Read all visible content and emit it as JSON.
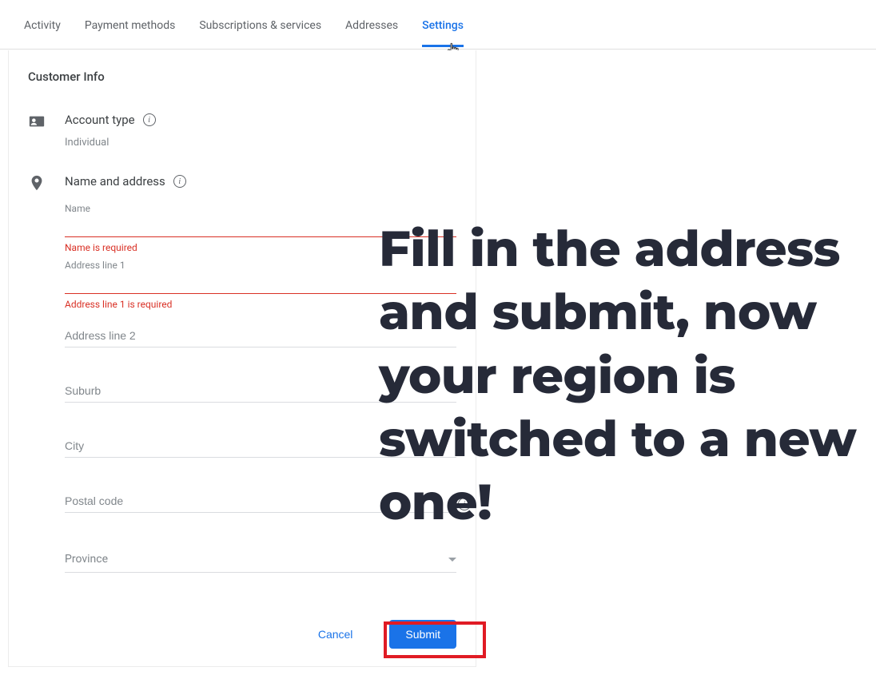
{
  "tabs": {
    "activity": "Activity",
    "payment_methods": "Payment methods",
    "subscriptions": "Subscriptions & services",
    "addresses": "Addresses",
    "settings": "Settings"
  },
  "panel": {
    "title": "Customer Info",
    "account_type": {
      "label": "Account type",
      "value": "Individual"
    },
    "name_address": {
      "label": "Name and address"
    },
    "fields": {
      "name": {
        "label": "Name",
        "error": "Name is required"
      },
      "addr1": {
        "label": "Address line 1",
        "error": "Address line 1 is required"
      },
      "addr2": {
        "placeholder": "Address line 2"
      },
      "suburb": {
        "placeholder": "Suburb"
      },
      "city": {
        "placeholder": "City"
      },
      "postal": {
        "placeholder": "Postal code"
      },
      "province": {
        "placeholder": "Province"
      }
    },
    "actions": {
      "cancel": "Cancel",
      "submit": "Submit"
    }
  },
  "overlay": {
    "text": "Fill in the address and submit, now your region is switched to a new one!"
  }
}
